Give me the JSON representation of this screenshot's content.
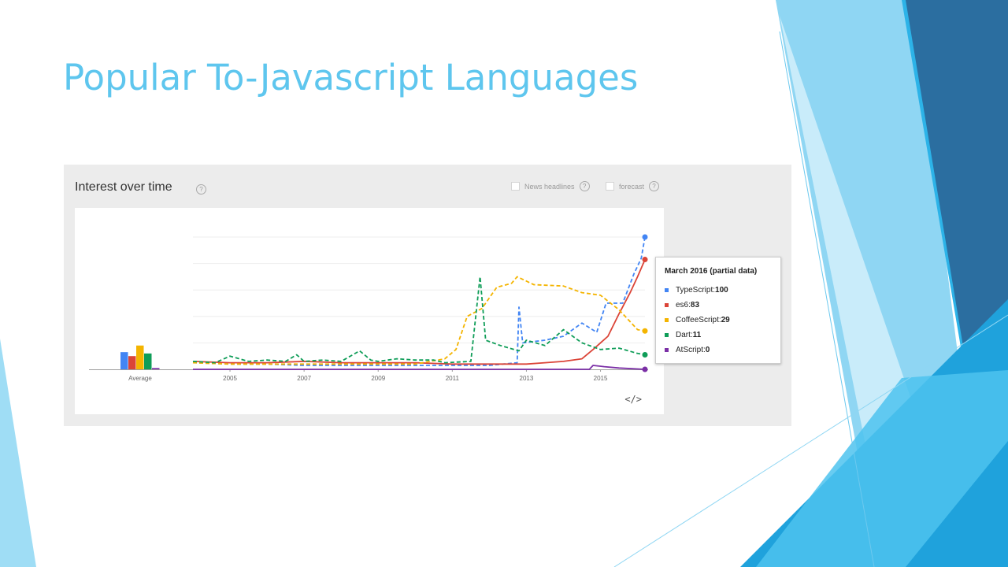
{
  "slide": {
    "title": "Popular To-Javascript Languages"
  },
  "panel": {
    "title": "Interest over time",
    "help_glyph": "?",
    "options": [
      {
        "label": "News headlines",
        "checked": false
      },
      {
        "label": "forecast",
        "checked": false
      }
    ],
    "embed_glyph": "</>"
  },
  "chart_data": {
    "type": "line",
    "y_range": [
      0,
      100
    ],
    "grid": true,
    "x_ticks": [
      "2005",
      "2007",
      "2009",
      "2011",
      "2013",
      "2015"
    ],
    "x_range": [
      2004.0,
      2016.2
    ],
    "average_label": "Average",
    "average_values": [
      13,
      10,
      18,
      12,
      1
    ],
    "series": [
      {
        "name": "TypeScript",
        "color": "#4285f4",
        "dashed": true,
        "points": [
          [
            2004.0,
            5
          ],
          [
            2005.0,
            4
          ],
          [
            2006.0,
            4
          ],
          [
            2007.0,
            3
          ],
          [
            2008.0,
            3
          ],
          [
            2009.0,
            3
          ],
          [
            2010.0,
            3
          ],
          [
            2011.0,
            3
          ],
          [
            2012.0,
            3
          ],
          [
            2012.75,
            5
          ],
          [
            2012.8,
            47
          ],
          [
            2012.9,
            20
          ],
          [
            2013.5,
            22
          ],
          [
            2014.0,
            25
          ],
          [
            2014.5,
            35
          ],
          [
            2014.9,
            28
          ],
          [
            2015.15,
            50
          ],
          [
            2015.6,
            50
          ],
          [
            2015.9,
            72
          ],
          [
            2016.1,
            84
          ],
          [
            2016.2,
            100
          ]
        ]
      },
      {
        "name": "es6",
        "color": "#db4437",
        "dashed": false,
        "points": [
          [
            2004.0,
            6
          ],
          [
            2005.0,
            5
          ],
          [
            2006.0,
            5
          ],
          [
            2007.0,
            6
          ],
          [
            2008.0,
            5
          ],
          [
            2009.0,
            5
          ],
          [
            2010.0,
            5
          ],
          [
            2011.0,
            4
          ],
          [
            2012.0,
            4
          ],
          [
            2013.0,
            4
          ],
          [
            2013.5,
            5
          ],
          [
            2014.0,
            6
          ],
          [
            2014.5,
            8
          ],
          [
            2014.8,
            15
          ],
          [
            2015.2,
            25
          ],
          [
            2015.5,
            42
          ],
          [
            2015.8,
            58
          ],
          [
            2016.0,
            70
          ],
          [
            2016.2,
            83
          ]
        ]
      },
      {
        "name": "CoffeeScript",
        "color": "#f4b400",
        "dashed": true,
        "points": [
          [
            2004.0,
            5
          ],
          [
            2005.0,
            4
          ],
          [
            2006.0,
            4
          ],
          [
            2007.0,
            4
          ],
          [
            2008.0,
            4
          ],
          [
            2009.0,
            4
          ],
          [
            2010.0,
            4
          ],
          [
            2010.8,
            8
          ],
          [
            2011.1,
            15
          ],
          [
            2011.4,
            40
          ],
          [
            2011.8,
            46
          ],
          [
            2012.2,
            62
          ],
          [
            2012.6,
            65
          ],
          [
            2012.75,
            70
          ],
          [
            2013.2,
            64
          ],
          [
            2014.0,
            63
          ],
          [
            2014.5,
            58
          ],
          [
            2015.0,
            56
          ],
          [
            2015.5,
            45
          ],
          [
            2016.0,
            30
          ],
          [
            2016.2,
            29
          ]
        ]
      },
      {
        "name": "Dart",
        "color": "#0f9d58",
        "dashed": true,
        "points": [
          [
            2004.0,
            6
          ],
          [
            2004.6,
            5
          ],
          [
            2005.0,
            10
          ],
          [
            2005.5,
            6
          ],
          [
            2006.0,
            7
          ],
          [
            2006.5,
            6
          ],
          [
            2006.8,
            11
          ],
          [
            2007.0,
            6
          ],
          [
            2007.5,
            7
          ],
          [
            2008.0,
            6
          ],
          [
            2008.5,
            14
          ],
          [
            2008.8,
            7
          ],
          [
            2009.0,
            6
          ],
          [
            2009.5,
            8
          ],
          [
            2010.0,
            7
          ],
          [
            2010.5,
            7
          ],
          [
            2010.8,
            5
          ],
          [
            2011.5,
            6
          ],
          [
            2011.75,
            70
          ],
          [
            2011.9,
            22
          ],
          [
            2012.3,
            18
          ],
          [
            2012.8,
            14
          ],
          [
            2013.0,
            22
          ],
          [
            2013.5,
            18
          ],
          [
            2014.0,
            30
          ],
          [
            2014.5,
            20
          ],
          [
            2015.0,
            15
          ],
          [
            2015.5,
            16
          ],
          [
            2016.0,
            12
          ],
          [
            2016.2,
            11
          ]
        ]
      },
      {
        "name": "AtScript",
        "color": "#7b2fa6",
        "dashed": false,
        "points": [
          [
            2004.0,
            0
          ],
          [
            2014.7,
            0
          ],
          [
            2014.8,
            3
          ],
          [
            2015.1,
            2
          ],
          [
            2015.5,
            1
          ],
          [
            2016.2,
            0
          ]
        ]
      }
    ]
  },
  "tooltip": {
    "title": "March 2016 (partial data)",
    "rows": [
      {
        "name": "TypeScript",
        "label": "TypeScript: ",
        "value": "100",
        "color": "#4285f4"
      },
      {
        "name": "es6",
        "label": "es6: ",
        "value": "83",
        "color": "#db4437"
      },
      {
        "name": "CoffeeScript",
        "label": "CoffeeScript: ",
        "value": "29",
        "color": "#f4b400"
      },
      {
        "name": "Dart",
        "label": "Dart: ",
        "value": "11",
        "color": "#0f9d58"
      },
      {
        "name": "AtScript",
        "label": "AtScript: ",
        "value": "0",
        "color": "#7b2fa6"
      }
    ]
  },
  "theme": {
    "title_color": "#5ec6ee",
    "accent_dark": "#2b6ea0",
    "accent_mid": "#29a9e0",
    "accent_light": "#7fd0f0"
  }
}
